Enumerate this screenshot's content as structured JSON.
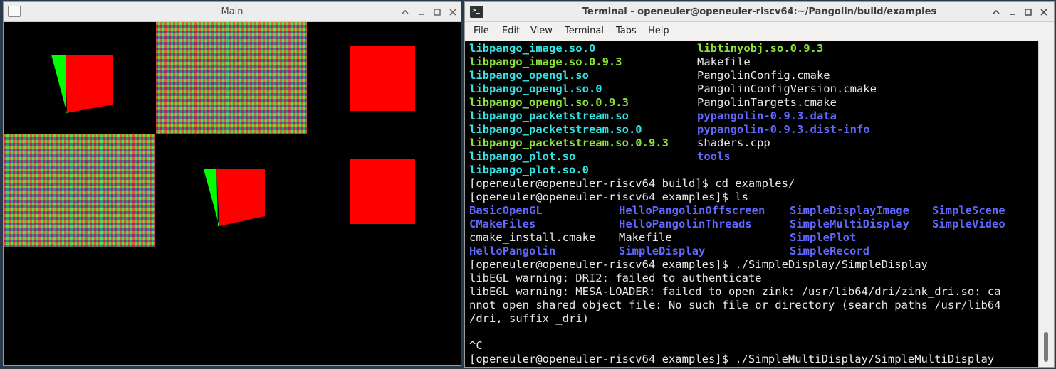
{
  "main_window": {
    "title": "Main"
  },
  "terminal_window": {
    "title": "Terminal - openeuler@openeuler-riscv64:~/Pangolin/build/examples",
    "menu": [
      "File",
      "Edit",
      "View",
      "Terminal",
      "Tabs",
      "Help"
    ],
    "lines": [
      [
        "libpango_image.so.0",
        "libtinyobj.so.0.9.3"
      ],
      [
        "libpango_image.so.0.9.3",
        "Makefile"
      ],
      [
        "libpango_opengl.so",
        "PangolinConfig.cmake"
      ],
      [
        "libpango_opengl.so.0",
        "PangolinConfigVersion.cmake"
      ],
      [
        "libpango_opengl.so.0.9.3",
        "PangolinTargets.cmake"
      ],
      [
        "libpango_packetstream.so",
        "pypangolin-0.9.3.data"
      ],
      [
        "libpango_packetstream.so.0",
        "pypangolin-0.9.3.dist-info"
      ],
      [
        "libpango_packetstream.so.0.9.3",
        "shaders.cpp"
      ],
      [
        "libpango_plot.so",
        "tools"
      ],
      [
        "libpango_plot.so.0"
      ],
      [
        "[openeuler@openeuler-riscv64 build]$ cd examples/"
      ],
      [
        "[openeuler@openeuler-riscv64 examples]$ ls"
      ],
      [
        "BasicOpenGL",
        "HelloPangolinOffscreen",
        "SimpleDisplayImage",
        "SimpleScene"
      ],
      [
        "CMakeFiles",
        "HelloPangolinThreads",
        "SimpleMultiDisplay",
        "SimpleVideo"
      ],
      [
        "cmake_install.cmake",
        "Makefile",
        "SimplePlot"
      ],
      [
        "HelloPangolin",
        "SimpleDisplay",
        "SimpleRecord"
      ],
      [
        "[openeuler@openeuler-riscv64 examples]$ ./SimpleDisplay/SimpleDisplay"
      ],
      [
        "libEGL warning: DRI2: failed to authenticate"
      ],
      [
        "libEGL warning: MESA-LOADER: failed to open zink: /usr/lib64/dri/zink_dri.so: ca"
      ],
      [
        "nnot open shared object file: No such file or directory (search paths /usr/lib64"
      ],
      [
        "/dri, suffix _dri)"
      ],
      [
        ""
      ],
      [
        "^C"
      ],
      [
        "[openeuler@openeuler-riscv64 examples]$ ./SimpleMultiDisplay/SimpleMultiDisplay"
      ]
    ]
  },
  "colors": {
    "shared_lib": "#34e2e2",
    "versioned_lib": "#8ae234",
    "directory": "#6068ff",
    "plain": "#e8e8e8",
    "render_red": "#ff0000",
    "render_green": "#00ff00"
  },
  "icons": {
    "main_window": "window-icon",
    "terminal": "terminal-icon",
    "controls": [
      "arrow-up-icon",
      "minimize-icon",
      "maximize-icon",
      "close-icon"
    ]
  }
}
